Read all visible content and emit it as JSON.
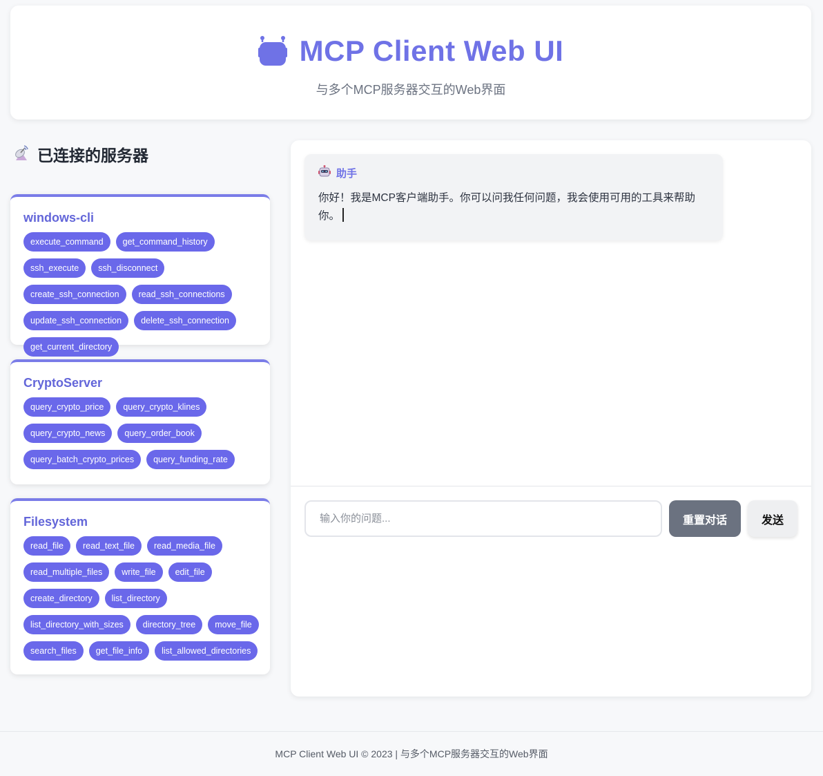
{
  "header": {
    "title": "MCP Client Web UI",
    "subtitle": "与多个MCP服务器交互的Web界面",
    "icon": "robot-icon",
    "accent_color": "#6f72e6"
  },
  "sidebar": {
    "title": "已连接的服务器",
    "icon": "satellite-icon",
    "servers": [
      {
        "name": "windows-cli",
        "tools": [
          "execute_command",
          "get_command_history",
          "ssh_execute",
          "ssh_disconnect",
          "create_ssh_connection",
          "read_ssh_connections",
          "update_ssh_connection",
          "delete_ssh_connection",
          "get_current_directory"
        ]
      },
      {
        "name": "CryptoServer",
        "tools": [
          "query_crypto_price",
          "query_crypto_klines",
          "query_crypto_news",
          "query_order_book",
          "query_batch_crypto_prices",
          "query_funding_rate"
        ]
      },
      {
        "name": "Filesystem",
        "tools": [
          "read_file",
          "read_text_file",
          "read_media_file",
          "read_multiple_files",
          "write_file",
          "edit_file",
          "create_directory",
          "list_directory",
          "list_directory_with_sizes",
          "directory_tree",
          "move_file",
          "search_files",
          "get_file_info",
          "list_allowed_directories"
        ]
      }
    ],
    "tool_chip_color": "#6a68ea"
  },
  "chat": {
    "messages": [
      {
        "sender": "助手",
        "icon": "robot-icon",
        "text": "你好！我是MCP客户端助手。你可以问我任何问题，我会使用可用的工具来帮助你。"
      }
    ],
    "input_placeholder": "输入你的问题...",
    "input_value": "",
    "reset_label": "重置对话",
    "send_label": "发送"
  },
  "footer": {
    "text": "MCP Client Web UI © 2023 | 与多个MCP服务器交互的Web界面"
  }
}
